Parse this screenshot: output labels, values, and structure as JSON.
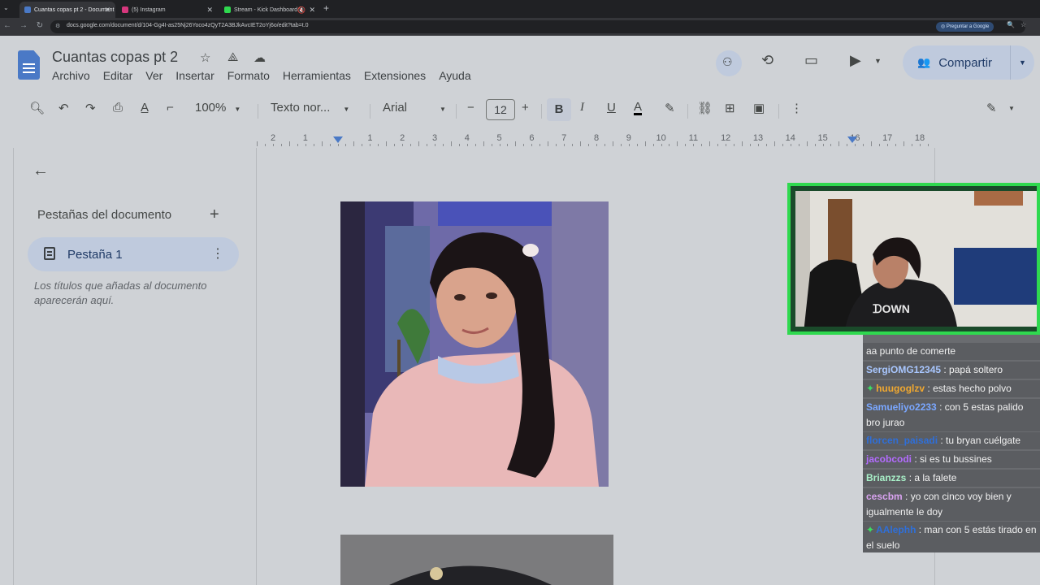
{
  "browser": {
    "tabs": [
      {
        "title": "Cuantas copas pt 2 - Document",
        "favicon_color": "#4a79c6",
        "active": true
      },
      {
        "title": "(5) Instagram",
        "favicon_color": "#d6377d",
        "active": false
      },
      {
        "title": "Stream - Kick Dashboard",
        "favicon_color": "#2fd94f",
        "active": false
      }
    ],
    "url": "docs.google.com/document/d/104-Gg4I-as25Nj26Yoco4zQyT2A3BJkAvcIET2oYj6o/edit?tab=t.0",
    "ask_google": "Preguntar a Google"
  },
  "docs": {
    "title": "Cuantas copas pt 2",
    "menu": [
      "Archivo",
      "Editar",
      "Ver",
      "Insertar",
      "Formato",
      "Herramientas",
      "Extensiones",
      "Ayuda"
    ],
    "share_label": "Compartir",
    "toolbar": {
      "zoom": "100%",
      "style": "Texto nor...",
      "font": "Arial",
      "font_size": "12"
    },
    "ruler_numbers": [
      "2",
      "1",
      "",
      "1",
      "2",
      "3",
      "4",
      "5",
      "6",
      "7",
      "8",
      "9",
      "10",
      "11",
      "12",
      "13",
      "14",
      "15",
      "16",
      "17",
      "18"
    ],
    "sidebar": {
      "heading": "Pestañas del documento",
      "tab_label": "Pestaña 1",
      "hint": "Los títulos que añadas al documento aparecerán aquí."
    }
  },
  "chat": {
    "messages": [
      {
        "user": "",
        "text": "aa punto de comerte",
        "color": "#f1f1f1",
        "badge": false
      },
      {
        "user": "SergiOMG12345",
        "text": ": papá soltero",
        "color": "#a9c7ff",
        "badge": false
      },
      {
        "user": "huugoglzv",
        "text": ": estas hecho polvo",
        "color": "#f0a830",
        "badge": true
      },
      {
        "user": "Samueliyo2233",
        "text": ": con 5 estas palido bro jurao",
        "color": "#7aa7ff",
        "badge": false
      },
      {
        "user": "florcen_paisadi",
        "text": ": tu bryan cuélgate",
        "color": "#2f6fd9",
        "badge": false
      },
      {
        "user": "jacobcodi",
        "text": ": si es tu bussines",
        "color": "#b36bff",
        "badge": false
      },
      {
        "user": "Brianzzs",
        "text": ": a la falete",
        "color": "#a8f0c8",
        "badge": false
      },
      {
        "user": "cescbm",
        "text": ": yo con cinco voy bien y igualmente le doy",
        "color": "#d9a3f0",
        "badge": false
      },
      {
        "user": "AAlephh",
        "text": ": man con 5 estás tirado en el suelo",
        "color": "#2f6fd9",
        "badge": true
      }
    ]
  }
}
